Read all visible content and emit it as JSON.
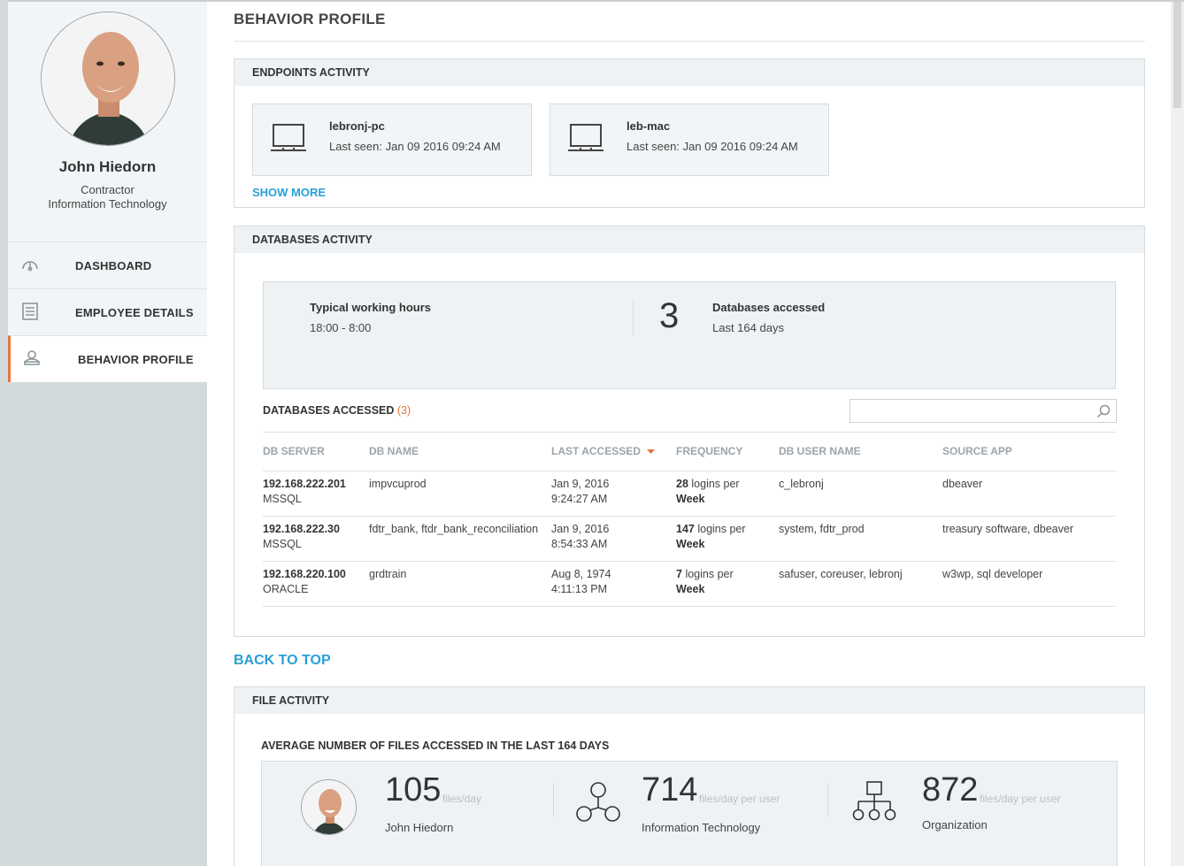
{
  "user": {
    "name": "John Hiedorn",
    "role": "Contractor",
    "department": "Information Technology"
  },
  "nav": {
    "items": [
      {
        "label": "DASHBOARD",
        "icon": "gauge-icon"
      },
      {
        "label": "EMPLOYEE DETAILS",
        "icon": "document-icon"
      },
      {
        "label": "BEHAVIOR PROFILE",
        "icon": "profile-icon"
      }
    ],
    "active": "BEHAVIOR PROFILE"
  },
  "page": {
    "title": "BEHAVIOR PROFILE"
  },
  "endpoints": {
    "title": "ENDPOINTS ACTIVITY",
    "items": [
      {
        "name": "lebronj-pc",
        "last_seen": "Last seen: Jan 09 2016 09:24 AM",
        "icon": "laptop-icon"
      },
      {
        "name": "leb-mac",
        "last_seen": "Last seen: Jan 09 2016 09:24 AM",
        "icon": "laptop-icon"
      }
    ],
    "show_more": "SHOW MORE"
  },
  "databases": {
    "title": "DATABASES ACTIVITY",
    "summary": {
      "hours_label": "Typical working hours",
      "hours_value": "18:00 - 8:00",
      "count": "3",
      "count_label": "Databases accessed",
      "count_period": "Last 164 days"
    },
    "table_title": "DATABASES ACCESSED",
    "table_count": "(3)",
    "search_placeholder": "",
    "columns": [
      "DB SERVER",
      "DB NAME",
      "LAST ACCESSED",
      "FREQUENCY",
      "DB USER NAME",
      "SOURCE APP"
    ],
    "rows": [
      {
        "server": "192.168.222.201",
        "type": "MSSQL",
        "db_name": "impvcuprod",
        "date": "Jan 9, 2016",
        "time": "9:24:27 AM",
        "freq_num": "28",
        "freq_text": "logins per",
        "freq_period": "Week",
        "user": "c_lebronj",
        "app": "dbeaver"
      },
      {
        "server": "192.168.222.30",
        "type": "MSSQL",
        "db_name": "fdtr_bank, ftdr_bank_reconciliation",
        "date": "Jan 9, 2016",
        "time": "8:54:33 AM",
        "freq_num": "147",
        "freq_text": "logins per",
        "freq_period": "Week",
        "user": "system, fdtr_prod",
        "app": "treasury software, dbeaver"
      },
      {
        "server": "192.168.220.100",
        "type": "ORACLE",
        "db_name": "grdtrain",
        "date": "Aug 8, 1974",
        "time": "4:11:13 PM",
        "freq_num": "7",
        "freq_text": "logins per",
        "freq_period": "Week",
        "user": "safuser, coreuser, lebronj",
        "app": "w3wp, sql developer"
      }
    ]
  },
  "back_to_top": "BACK TO TOP",
  "files": {
    "title": "FILE ACTIVITY",
    "subtitle": "AVERAGE NUMBER OF FILES ACCESSED IN THE LAST 164 DAYS",
    "stats": [
      {
        "value": "105",
        "unit": "files/day",
        "label": "John Hiedorn",
        "icon": "avatar"
      },
      {
        "value": "714",
        "unit": "files/day per user",
        "label": "Information Technology",
        "icon": "network-icon"
      },
      {
        "value": "872",
        "unit": "files/day per user",
        "label": "Organization",
        "icon": "org-chart-icon"
      }
    ]
  },
  "colors": {
    "accent": "#2a9fd6",
    "active_marker": "#e8733e",
    "sort_arrow": "#e8733e"
  }
}
